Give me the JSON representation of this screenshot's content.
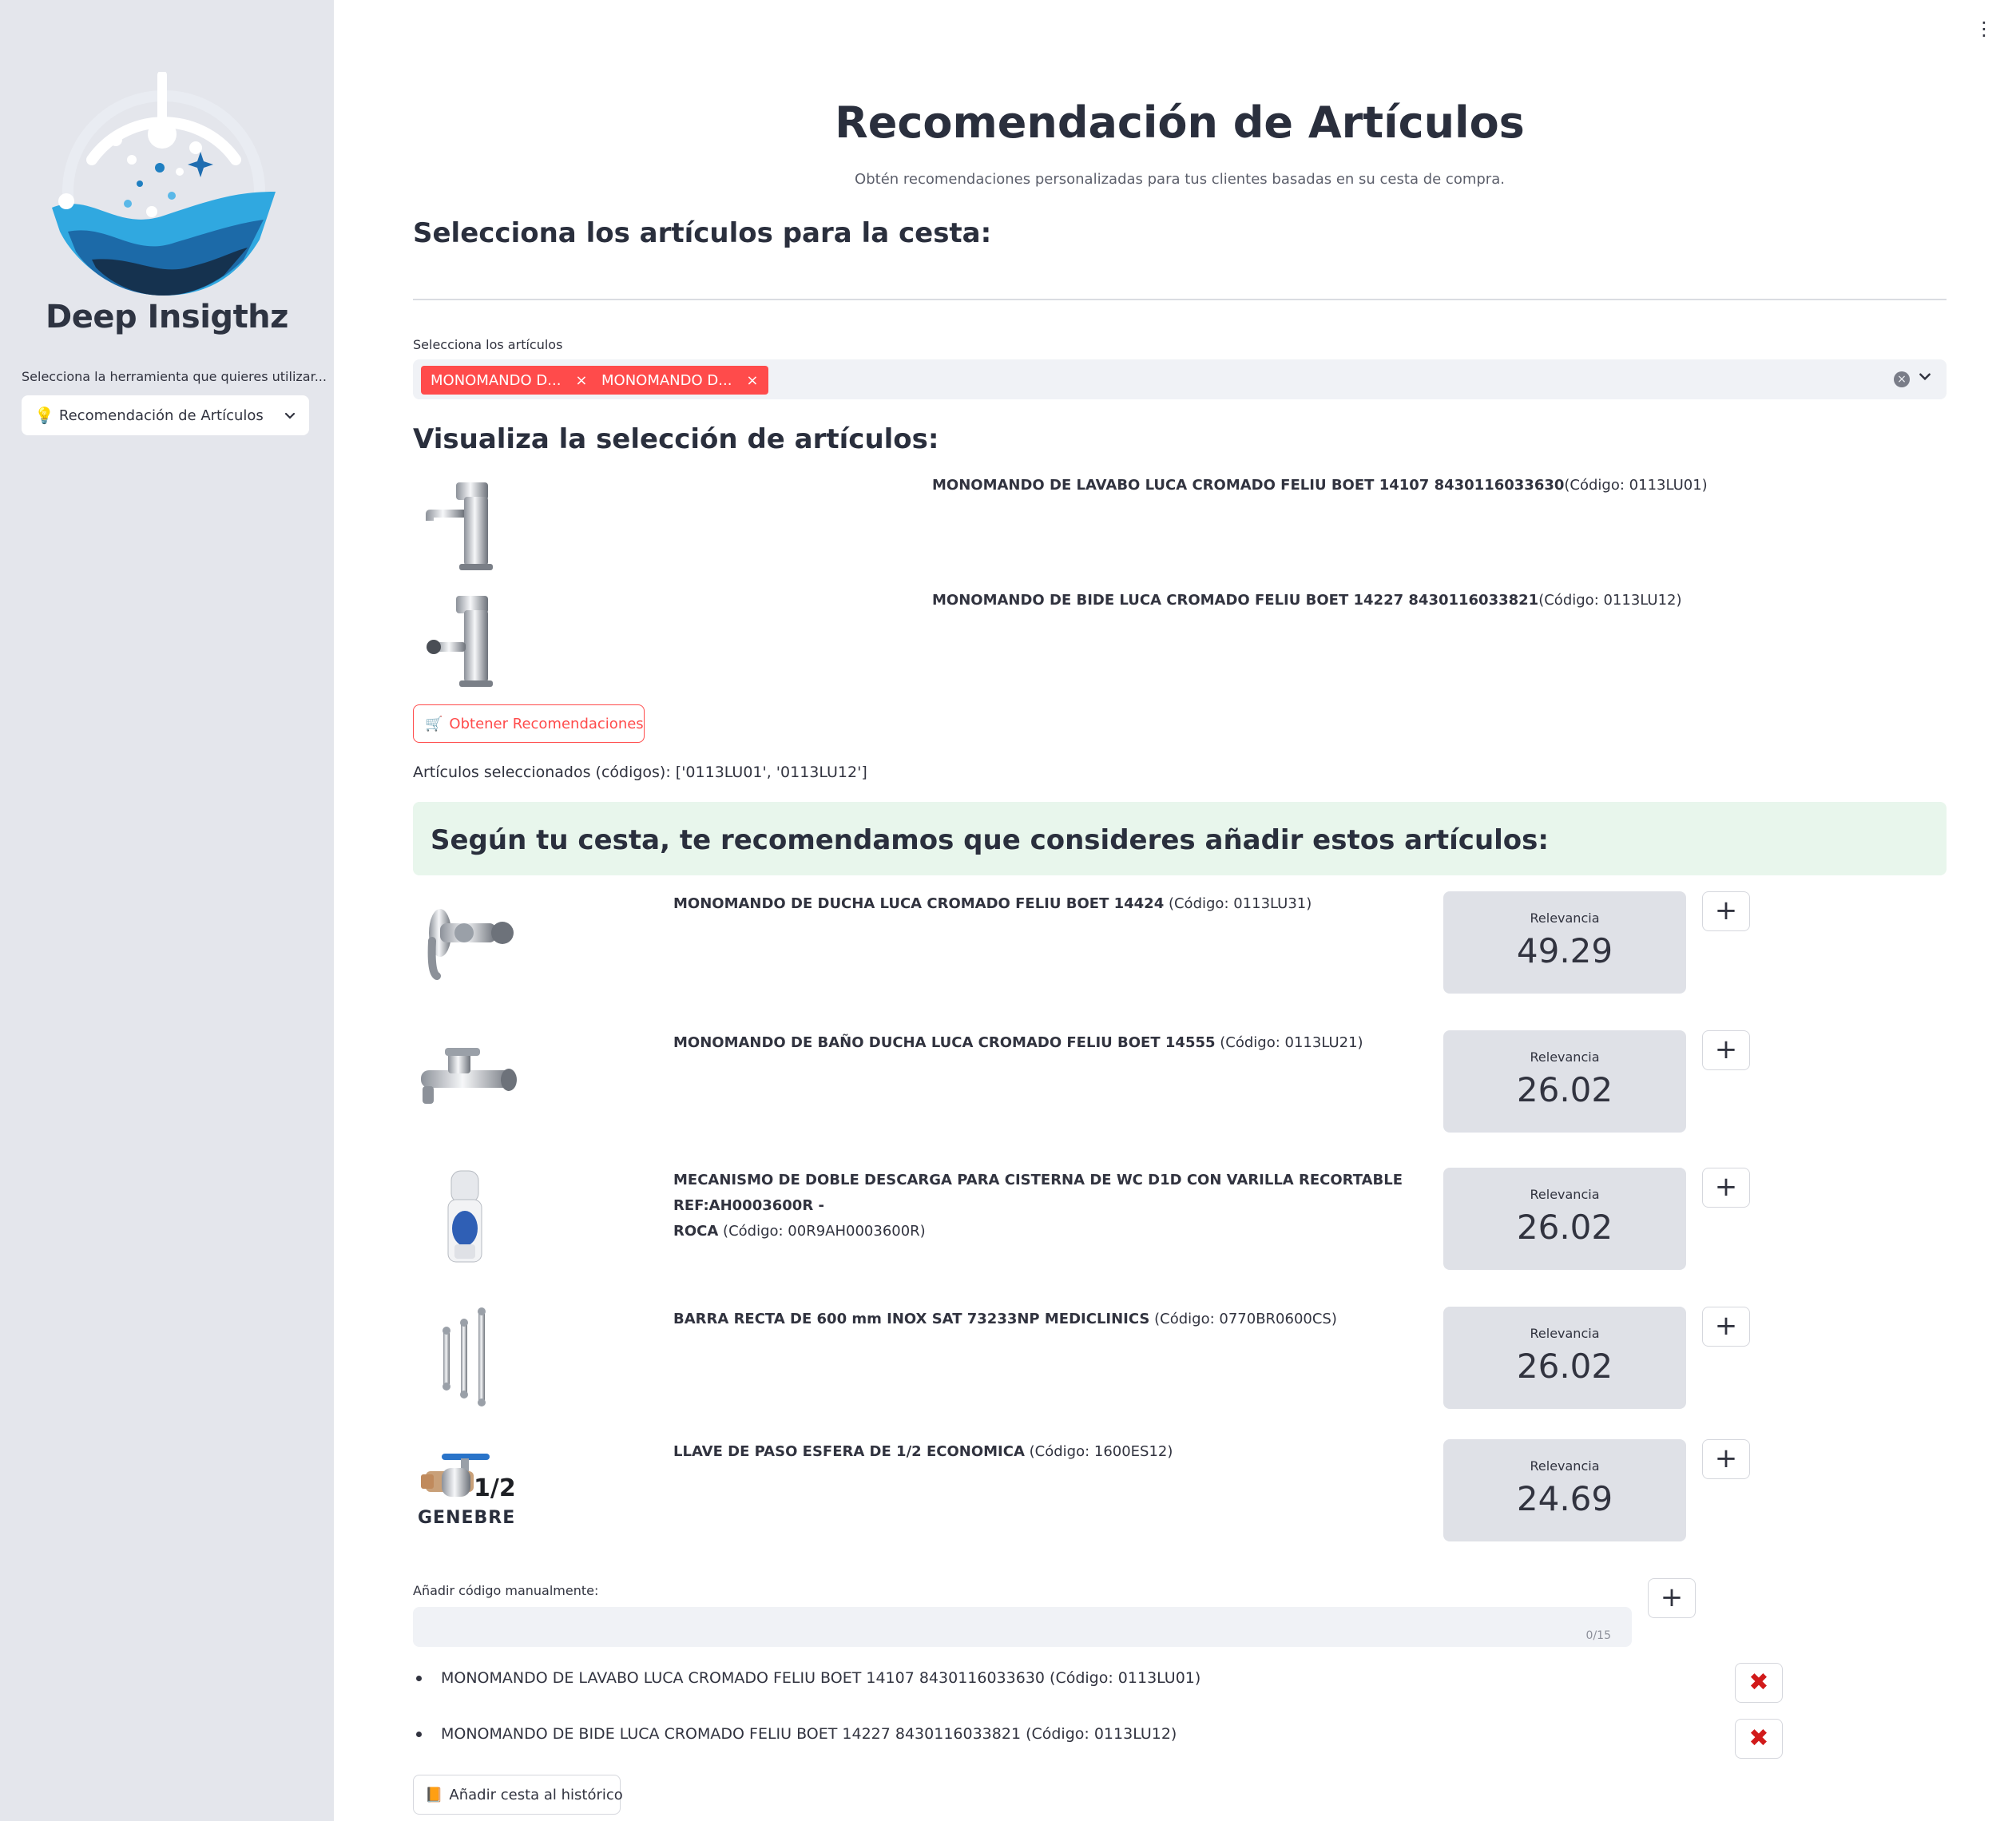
{
  "sidebar": {
    "brand": "Deep Insigthz",
    "tool_label": "Selecciona la herramienta que quieres utilizar...",
    "tool_selected": "Recomendación de Artículos"
  },
  "header": {
    "title": "Recomendación de Artículos",
    "subtitle": "Obtén recomendaciones personalizadas para tus clientes basadas en su cesta de compra."
  },
  "basket_section": {
    "heading": "Selecciona los artículos para la cesta:",
    "multiselect_label": "Selecciona los artículos",
    "tags": [
      "MONOMANDO D...",
      "MONOMANDO D..."
    ],
    "remove_glyph": "×"
  },
  "visualize_section": {
    "heading": "Visualiza la selección de artículos:",
    "items": [
      {
        "name": "MONOMANDO DE LAVABO LUCA CROMADO FELIU BOET 14107 8430116033630",
        "code": "(Código: 0113LU01)"
      },
      {
        "name": "MONOMANDO DE BIDE LUCA CROMADO FELIU BOET 14227 8430116033821",
        "code": "(Código: 0113LU12)"
      }
    ],
    "get_button": "Obtener Recomendaciones",
    "selected_codes": "Artículos seleccionados (códigos): ['0113LU01', '0113LU12']"
  },
  "recommendations": {
    "banner": "Según tu cesta, te recomendamos que consideres añadir estos artículos:",
    "metric_label": "Relevancia",
    "items": [
      {
        "name": "MONOMANDO DE DUCHA LUCA CROMADO FELIU BOET 14424",
        "code": "(Código: 0113LU31)",
        "relevance": "49.29"
      },
      {
        "name": "MONOMANDO DE BAÑO DUCHA LUCA CROMADO FELIU BOET 14555",
        "code": "(Código: 0113LU21)",
        "relevance": "26.02"
      },
      {
        "name_line1": "MECANISMO DE DOBLE DESCARGA PARA CISTERNA DE WC D1D CON VARILLA RECORTABLE REF:AH0003600R -",
        "name_line2": "ROCA",
        "code": "(Código: 00R9AH0003600R)",
        "relevance": "26.02"
      },
      {
        "name": "BARRA RECTA DE 600 mm INOX SAT 73233NP MEDICLINICS",
        "code": "(Código: 0770BR0600CS)",
        "relevance": "26.02"
      },
      {
        "name": "LLAVE DE PASO ESFERA DE 1/2 ECONOMICA",
        "code": "(Código: 1600ES12)",
        "relevance": "24.69"
      }
    ],
    "genebre_fraction": "1/2",
    "genebre_brand": "GENEBRE"
  },
  "manual": {
    "label": "Añadir código manualmente:",
    "value": "",
    "counter": "0/15"
  },
  "basket_list": [
    "MONOMANDO DE LAVABO LUCA CROMADO FELIU BOET 14107 8430116033630 (Código: 0113LU01)",
    "MONOMANDO DE BIDE LUCA CROMADO FELIU BOET 14227 8430116033821 (Código: 0113LU12)"
  ],
  "history_button": "Añadir cesta al histórico",
  "colors": {
    "accent": "#ff4b4b",
    "sidebar": "#e4e6ec",
    "success": "#e8f6ec",
    "metric": "#dfe1e7"
  }
}
